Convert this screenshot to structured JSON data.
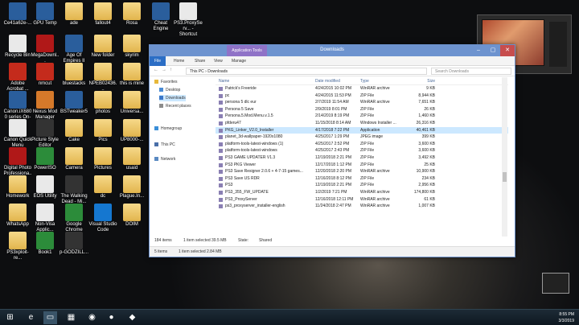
{
  "desktop": {
    "icons": [
      {
        "label": "Ce41a62e-...",
        "glyph": "g-app",
        "icon": "app-icon"
      },
      {
        "label": "GPU Temp",
        "glyph": "g-app",
        "icon": "app-icon"
      },
      {
        "label": "ade",
        "glyph": "g-folder",
        "icon": "folder-icon"
      },
      {
        "label": "fallout4",
        "glyph": "g-folder",
        "icon": "folder-icon"
      },
      {
        "label": "Rosa",
        "glyph": "g-folder",
        "icon": "folder-icon"
      },
      {
        "label": "Cheat Engine",
        "glyph": "g-app",
        "icon": "app-icon"
      },
      {
        "label": "PS3.ProxyServ... - Shortcut",
        "glyph": "g-white",
        "icon": "shortcut-icon"
      },
      {
        "label": "Recycle Bin",
        "glyph": "g-white",
        "icon": "recycle-bin-icon"
      },
      {
        "label": "MegaDownl...",
        "glyph": "g-red",
        "icon": "app-icon"
      },
      {
        "label": "Age Of Empires II HD",
        "glyph": "g-app",
        "icon": "game-icon"
      },
      {
        "label": "New folder",
        "glyph": "g-folder",
        "icon": "folder-icon"
      },
      {
        "label": "skyrim",
        "glyph": "g-folder",
        "icon": "folder-icon"
      },
      {
        "label": "Adobe Acrobat ...",
        "glyph": "g-pdf",
        "icon": "pdf-icon"
      },
      {
        "label": "nmcut",
        "glyph": "g-pdf",
        "icon": "pdf-icon"
      },
      {
        "label": "bluestacks",
        "glyph": "g-folder",
        "icon": "folder-icon"
      },
      {
        "label": "NPEB02436...",
        "glyph": "g-folder",
        "icon": "folder-icon"
      },
      {
        "label": "this is mine",
        "glyph": "g-folder",
        "icon": "folder-icon"
      },
      {
        "label": "Canon.iX6800 series On-Scr...",
        "glyph": "g-app",
        "icon": "printer-icon"
      },
      {
        "label": "Nexus Mod Manager",
        "glyph": "g-orange",
        "icon": "app-icon"
      },
      {
        "label": "BSTweaker5",
        "glyph": "g-app",
        "icon": "app-icon"
      },
      {
        "label": "photos",
        "glyph": "g-folder",
        "icon": "folder-icon"
      },
      {
        "label": "Universa...",
        "glyph": "g-folder",
        "icon": "folder-icon"
      },
      {
        "label": "Canon Quick Menu",
        "glyph": "g-white",
        "icon": "app-icon"
      },
      {
        "label": "Picture Style Editor",
        "glyph": "g-dark",
        "icon": "app-icon"
      },
      {
        "label": "Cake",
        "glyph": "g-folder",
        "icon": "folder-icon"
      },
      {
        "label": "Pics",
        "glyph": "g-folder",
        "icon": "folder-icon"
      },
      {
        "label": "UP8000-...",
        "glyph": "g-folder",
        "icon": "folder-icon"
      },
      {
        "label": "Digital Photo Professiona...",
        "glyph": "g-red",
        "icon": "app-icon"
      },
      {
        "label": "PowerISO",
        "glyph": "g-green",
        "icon": "app-icon"
      },
      {
        "label": "Camera",
        "glyph": "g-folder",
        "icon": "folder-icon"
      },
      {
        "label": "Pictures",
        "glyph": "g-folder",
        "icon": "folder-icon"
      },
      {
        "label": "usaid",
        "glyph": "g-folder",
        "icon": "folder-icon"
      },
      {
        "label": "Homework",
        "glyph": "g-folder",
        "icon": "folder-icon"
      },
      {
        "label": "EOS Utility",
        "glyph": "g-white",
        "icon": "app-icon"
      },
      {
        "label": "The Walking Dead - Mi...",
        "glyph": "g-dark",
        "icon": "game-icon"
      },
      {
        "label": "dc",
        "glyph": "g-folder",
        "icon": "folder-icon"
      },
      {
        "label": "Plague.In...",
        "glyph": "g-folder",
        "icon": "folder-icon"
      },
      {
        "label": "WhatsApp",
        "glyph": "g-folder",
        "icon": "folder-icon"
      },
      {
        "label": "Non-Visa Applic...",
        "glyph": "g-white",
        "icon": "document-icon"
      },
      {
        "label": "Google Chrome",
        "glyph": "g-green",
        "icon": "chrome-icon"
      },
      {
        "label": "Visual Studio Code",
        "glyph": "g-blue",
        "icon": "vscode-icon"
      },
      {
        "label": "DOIM",
        "glyph": "g-folder",
        "icon": "folder-icon"
      },
      {
        "label": "PS3xploit-re...",
        "glyph": "g-folder",
        "icon": "folder-icon"
      },
      {
        "label": "Book1",
        "glyph": "g-green",
        "icon": "excel-icon"
      },
      {
        "label": "p-GODZILL...",
        "glyph": "g-dark",
        "icon": "app-icon"
      }
    ]
  },
  "explorer": {
    "title": "Downloads",
    "context_tab": "Application Tools",
    "tabs": [
      "File",
      "Home",
      "Share",
      "View",
      "Manage"
    ],
    "path": [
      "This PC",
      "Downloads"
    ],
    "search_placeholder": "Search Downloads",
    "nav": [
      {
        "label": "Favorites",
        "icon": "star-icon"
      },
      {
        "label": "Desktop",
        "icon": "desktop-icon"
      },
      {
        "label": "Downloads",
        "icon": "downloads-icon"
      },
      {
        "label": "Recent places",
        "icon": "recent-icon"
      },
      {
        "label": "Homegroup",
        "icon": "homegroup-icon"
      },
      {
        "label": "This PC",
        "icon": "computer-icon"
      },
      {
        "label": "Network",
        "icon": "network-icon"
      }
    ],
    "columns": {
      "name": "Name",
      "date": "Date modified",
      "type": "Type",
      "size": "Size"
    },
    "files": [
      {
        "name": "Patrick's Freeride",
        "date": "4/24/2015 10:02 PM",
        "type": "WinRAR archive",
        "size": "9 KB"
      },
      {
        "name": "pc",
        "date": "4/24/2015 11:53 PM",
        "type": "ZIP File",
        "size": "8,944 KB"
      },
      {
        "name": "persona 5 dlc eur",
        "date": "2/7/2019 11:54 AM",
        "type": "WinRAR archive",
        "size": "7,651 KB"
      },
      {
        "name": "Persona 5 Save",
        "date": "2/9/2019 8:01 PM",
        "type": "ZIP File",
        "size": "26 KB"
      },
      {
        "name": "Persona.5.Mod.Menu.v.1.5",
        "date": "2/14/2019 8:19 PM",
        "type": "ZIP File",
        "size": "1,460 KB"
      },
      {
        "name": "pfderu47",
        "date": "11/15/2018 8:14 AM",
        "type": "Windows Installer ...",
        "size": "26,316 KB"
      },
      {
        "name": "PKG_Linker_V2.0_Installer",
        "date": "4/17/2018 7:22 PM",
        "type": "Application",
        "size": "40,461 KB",
        "selected": true
      },
      {
        "name": "planet_3d-wallpaper-1920x1080",
        "date": "4/25/2017 1:29 PM",
        "type": "JPEG image",
        "size": "399 KB"
      },
      {
        "name": "platform-tools-latest-windows (1)",
        "date": "4/25/2017 2:52 PM",
        "type": "ZIP File",
        "size": "3,600 KB"
      },
      {
        "name": "platform-tools-latest-windows",
        "date": "4/25/2017 2:43 PM",
        "type": "ZIP File",
        "size": "3,600 KB"
      },
      {
        "name": "PS3 GAME UPDATER V1.3",
        "date": "12/19/2018 2:21 PM",
        "type": "ZIP File",
        "size": "3,492 KB"
      },
      {
        "name": "PS3 PKG Viewer",
        "date": "12/17/2018 1:12 PM",
        "type": "ZIP File",
        "size": "25 KB"
      },
      {
        "name": "PS3 Save Resigner 2.0.6 + 4-7-15 games...",
        "date": "12/20/2018 2:20 PM",
        "type": "WinRAR archive",
        "size": "10,900 KB"
      },
      {
        "name": "PS3 Save US RDR",
        "date": "12/16/2018 8:12 PM",
        "type": "ZIP File",
        "size": "234 KB"
      },
      {
        "name": "PS3",
        "date": "12/19/2018 2:21 PM",
        "type": "ZIP File",
        "size": "2,956 KB"
      },
      {
        "name": "PS3_355_FW_UPDATE",
        "date": "1/2/2019 7:21 PM",
        "type": "WinRAR archive",
        "size": "174,800 KB"
      },
      {
        "name": "PS3_ProxyServer",
        "date": "12/16/2018 12:11 PM",
        "type": "WinRAR archive",
        "size": "61 KB"
      },
      {
        "name": "ps3_proxyserver_installer-english",
        "date": "11/24/2018 2:47 PM",
        "type": "WinRAR archive",
        "size": "1,007 KB"
      }
    ],
    "status": {
      "items": "184 items",
      "selected": "1 item selected  39.5 MB",
      "state": "State:",
      "shared": "Shared"
    },
    "status2": {
      "items": "5 items",
      "selected": "1 item selected  2.84 MB"
    }
  },
  "taskbar": {
    "apps": [
      {
        "icon": "start-icon",
        "glyph": "⊞"
      },
      {
        "icon": "ie-icon",
        "glyph": "e"
      },
      {
        "icon": "explorer-icon",
        "glyph": "▭"
      },
      {
        "icon": "store-icon",
        "glyph": "▦"
      },
      {
        "icon": "chrome-icon",
        "glyph": "◉"
      },
      {
        "icon": "obs-icon",
        "glyph": "●"
      },
      {
        "icon": "app-icon",
        "glyph": "◆"
      }
    ],
    "time": "8:55 PM",
    "date": "3/3/2019"
  }
}
